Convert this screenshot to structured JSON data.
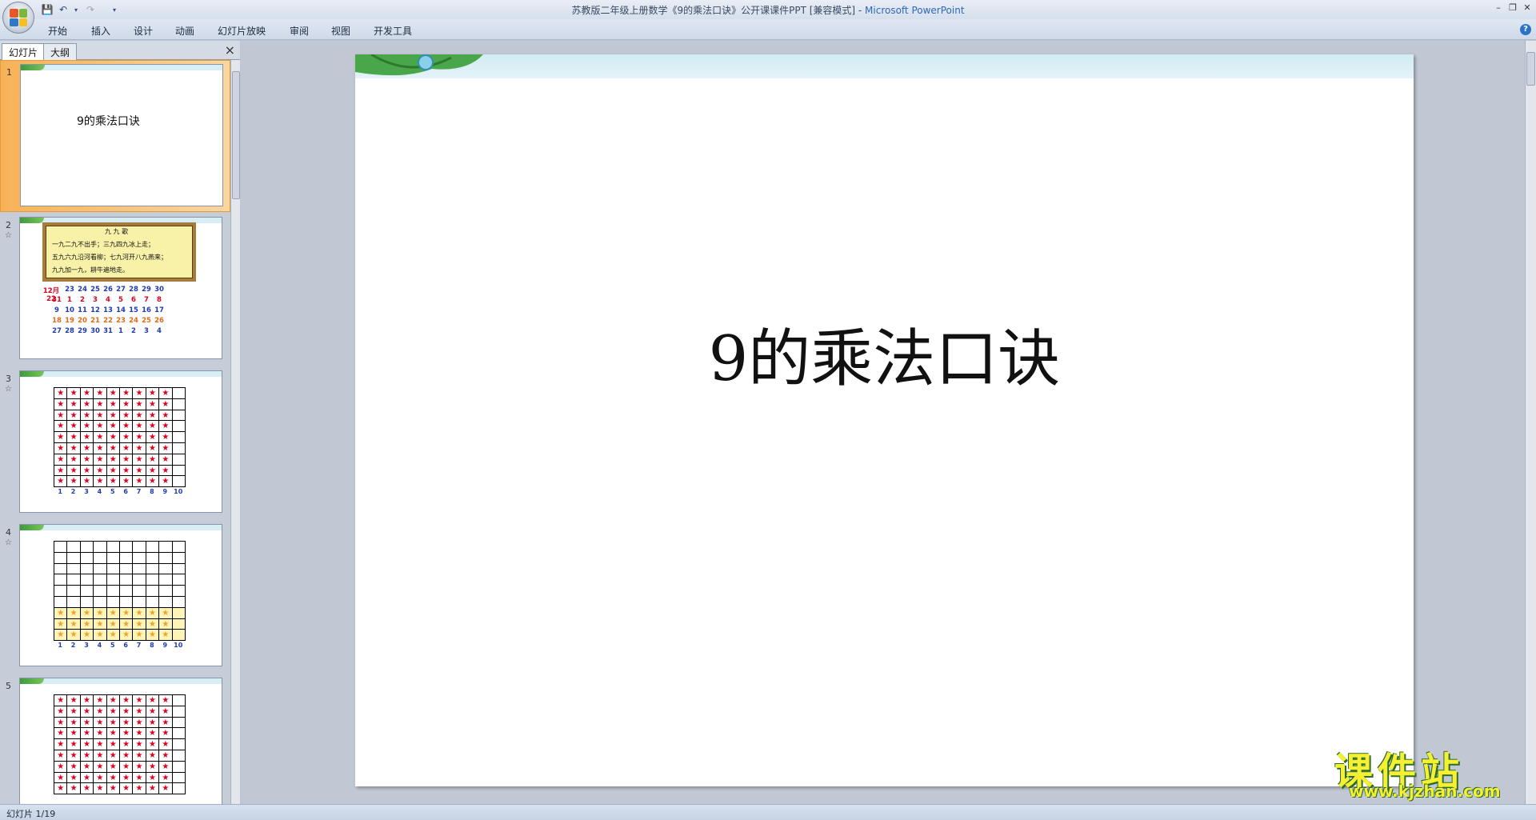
{
  "window": {
    "title": "苏教版二年级上册数学《9的乘法口诀》公开课课件PPT [兼容模式] - ",
    "app": "Microsoft PowerPoint"
  },
  "menu": [
    "开始",
    "插入",
    "设计",
    "动画",
    "幻灯片放映",
    "审阅",
    "视图",
    "开发工具"
  ],
  "panel": {
    "tab_slides": "幻灯片",
    "tab_outline": "大纲",
    "close": "×"
  },
  "thumbnails": [
    {
      "num": "1",
      "title": "9的乘法口诀"
    },
    {
      "num": "2"
    },
    {
      "num": "3"
    },
    {
      "num": "4"
    },
    {
      "num": "5"
    }
  ],
  "slide2": {
    "poem_title": "九  九  歌",
    "poem_lines": [
      "一九二九不出手；三九四九冰上走；",
      "五九六九沿河看柳；七九河开八九燕来；",
      "九九加一九，耕牛遍地走。"
    ],
    "calendar": [
      [
        "12月22",
        "23",
        "24",
        "25",
        "26",
        "27",
        "28",
        "29",
        "30"
      ],
      [
        "31",
        "1",
        "2",
        "3",
        "4",
        "5",
        "6",
        "7",
        "8"
      ],
      [
        "9",
        "10",
        "11",
        "12",
        "13",
        "14",
        "15",
        "16",
        "17"
      ],
      [
        "18",
        "19",
        "20",
        "21",
        "22",
        "23",
        "24",
        "25",
        "26"
      ],
      [
        "27",
        "28",
        "29",
        "30",
        "31",
        "1",
        "2",
        "3",
        "4"
      ]
    ]
  },
  "grid_numbers": [
    "1",
    "2",
    "3",
    "4",
    "5",
    "6",
    "7",
    "8",
    "9",
    "10"
  ],
  "main_slide": {
    "title": "9的乘法口诀"
  },
  "status": {
    "text": "幻灯片 1/19"
  },
  "watermark": {
    "cn": "课件站",
    "url": "www.kjzhan.com"
  },
  "colors": {
    "star_red": "#e0001a",
    "star_yellow": "#f0a030",
    "accent_orange": "#f7b257"
  }
}
